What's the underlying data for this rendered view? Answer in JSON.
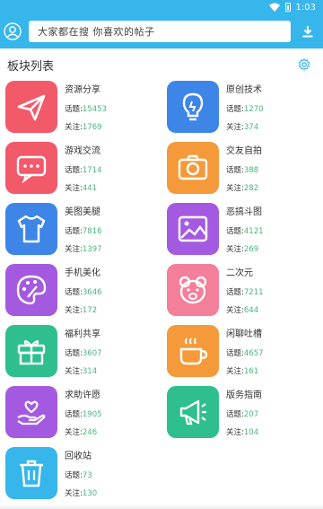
{
  "status": {
    "time": "1:03"
  },
  "search": {
    "placeholder": "大家都在搜  你喜欢的帖子"
  },
  "header": {
    "title": "板块列表"
  },
  "labels": {
    "topics": "话题:",
    "follows": "关注:"
  },
  "boards": [
    {
      "name": "资源分享",
      "topics": "15453",
      "follows": "1769",
      "icon": "paper-plane-icon",
      "color": "#f25a6a"
    },
    {
      "name": "原创技术",
      "topics": "1270",
      "follows": "374",
      "icon": "lightbulb-icon",
      "color": "#3d86e8"
    },
    {
      "name": "游戏交流",
      "topics": "1714",
      "follows": "441",
      "icon": "chat-bubble-icon",
      "color": "#f25a6a"
    },
    {
      "name": "交友自拍",
      "topics": "388",
      "follows": "282",
      "icon": "camera-icon",
      "color": "#f59a3a"
    },
    {
      "name": "美图美腿",
      "topics": "7816",
      "follows": "1397",
      "icon": "tshirt-icon",
      "color": "#3d86e8"
    },
    {
      "name": "恶搞斗图",
      "topics": "4121",
      "follows": "269",
      "icon": "picture-icon",
      "color": "#a45ae0"
    },
    {
      "name": "手机美化",
      "topics": "3646",
      "follows": "172",
      "icon": "palette-icon",
      "color": "#a45ae0"
    },
    {
      "name": "二次元",
      "topics": "7211",
      "follows": "644",
      "icon": "bear-face-icon",
      "color": "#f37f9a"
    },
    {
      "name": "福利共享",
      "topics": "3607",
      "follows": "314",
      "icon": "gift-icon",
      "color": "#2fbf8f"
    },
    {
      "name": "闲聊吐槽",
      "topics": "4657",
      "follows": "161",
      "icon": "coffee-cup-icon",
      "color": "#f59a3a"
    },
    {
      "name": "求助许愿",
      "topics": "1905",
      "follows": "246",
      "icon": "heart-hand-icon",
      "color": "#a45ae0"
    },
    {
      "name": "版务指南",
      "topics": "207",
      "follows": "104",
      "icon": "megaphone-icon",
      "color": "#2fbf8f"
    },
    {
      "name": "回收站",
      "topics": "73",
      "follows": "130",
      "icon": "trash-bin-icon",
      "color": "#36b6ea"
    }
  ]
}
